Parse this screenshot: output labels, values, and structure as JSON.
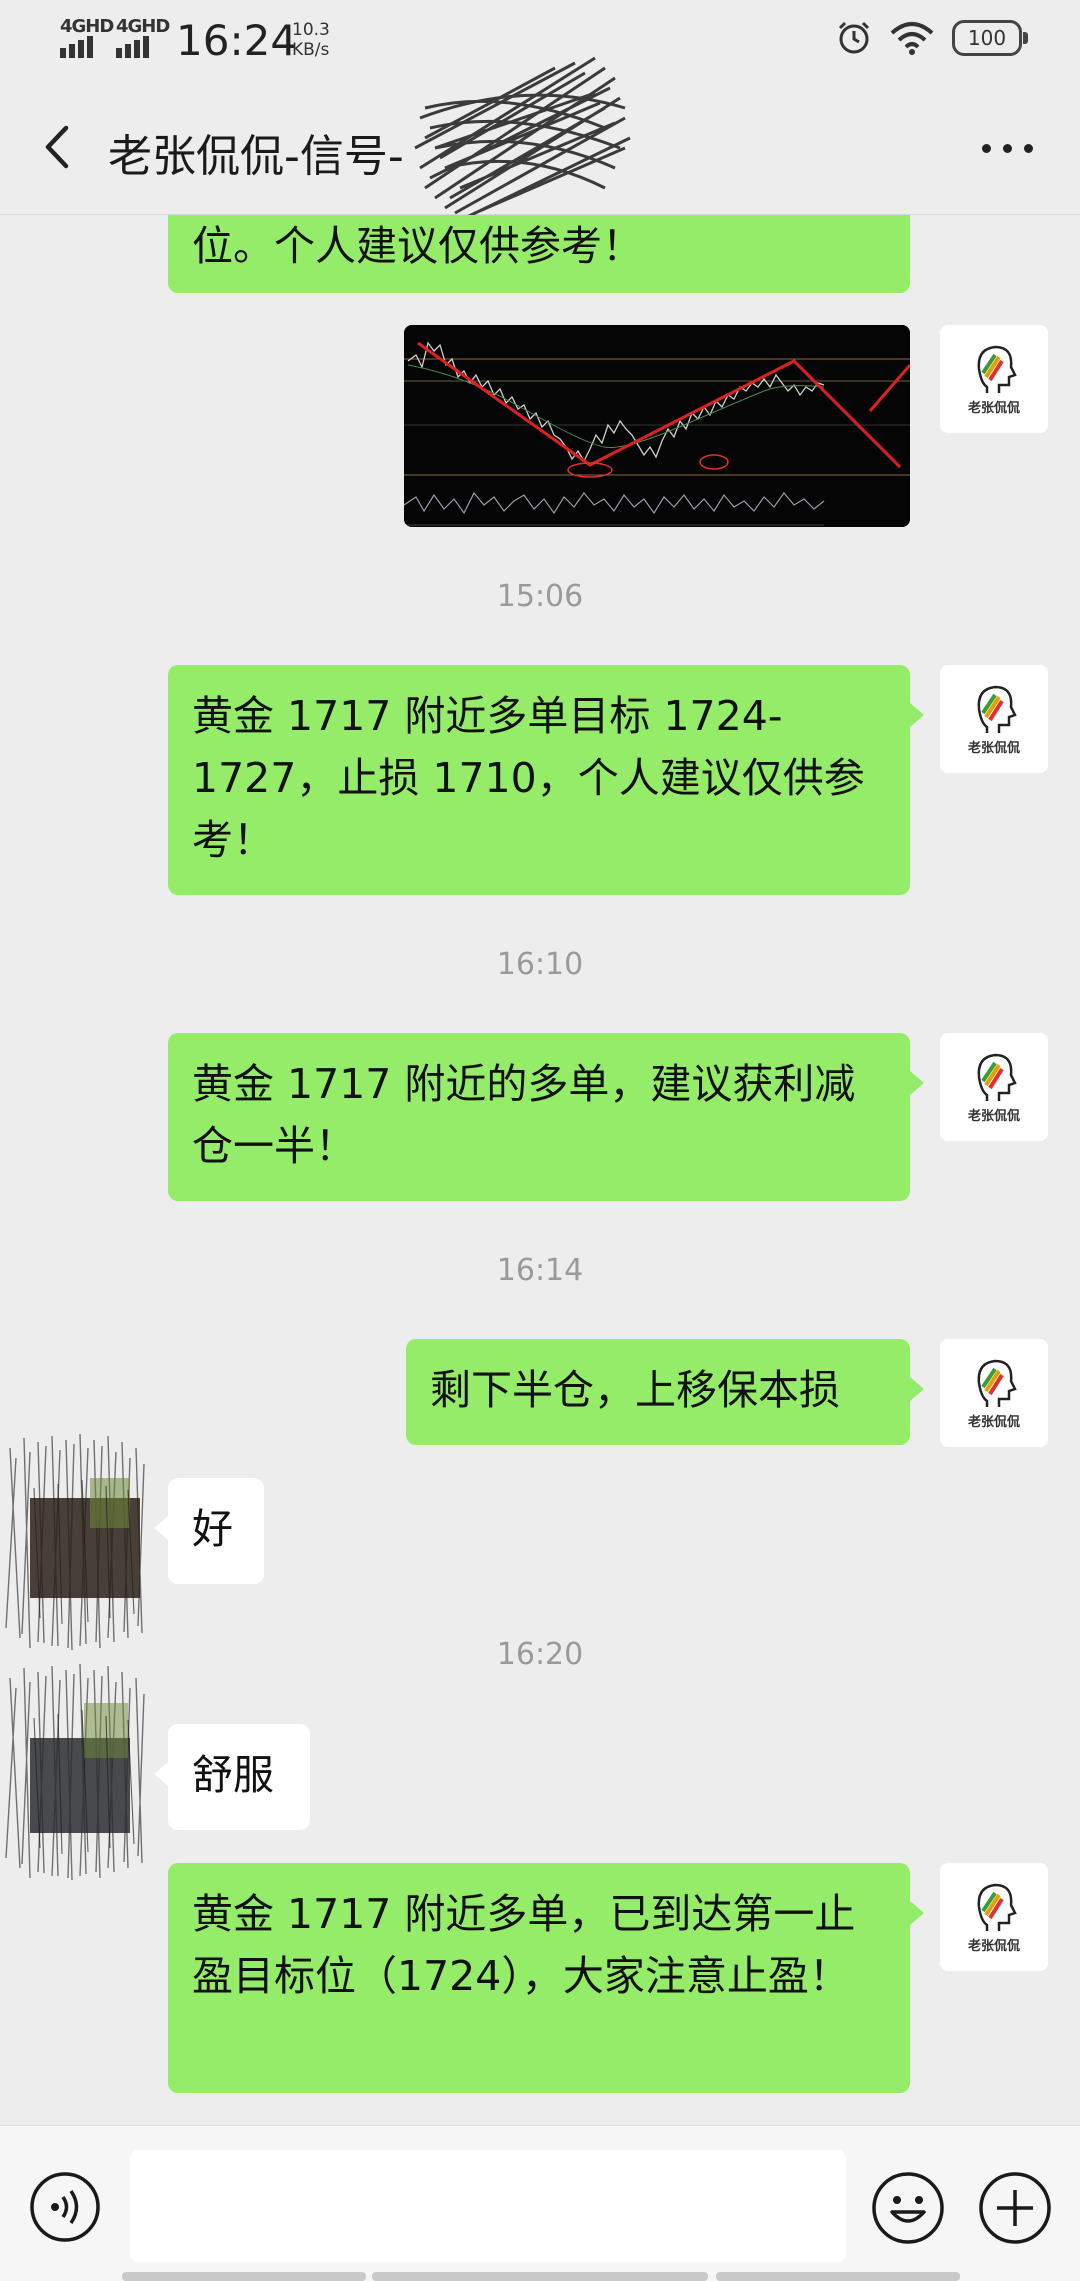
{
  "status_bar": {
    "net1": "4GHD",
    "net2": "4GHD",
    "time": "16:24",
    "speed_value": "10.3",
    "speed_unit": "KB/s",
    "battery": "100"
  },
  "header": {
    "title": "老张侃侃-信号-",
    "icons": [
      "back-arrow-icon",
      "more-icon"
    ]
  },
  "avatar_logo_text": "老张侃侃",
  "messages": [
    {
      "side": "right",
      "type": "text",
      "text": "位。个人建议仅供参考！"
    },
    {
      "side": "right",
      "type": "image",
      "icon": "candlestick-chart-image"
    },
    {
      "type": "time",
      "text": "15:06"
    },
    {
      "side": "right",
      "type": "text",
      "text": "黄金 1717 附近多单目标 1724-1727，止损 1710，个人建议仅供参考！"
    },
    {
      "type": "time",
      "text": "16:10"
    },
    {
      "side": "right",
      "type": "text",
      "text": "黄金 1717 附近的多单，建议获利减仓一半！"
    },
    {
      "type": "time",
      "text": "16:14"
    },
    {
      "side": "right",
      "type": "text",
      "text": "剩下半仓，上移保本损"
    },
    {
      "side": "left",
      "type": "text",
      "text": "好"
    },
    {
      "type": "time",
      "text": "16:20"
    },
    {
      "side": "left",
      "type": "text",
      "text": "舒服"
    },
    {
      "side": "right",
      "type": "text",
      "text": "黄金 1717 附近多单，已到达第一止盈目标位（1724），大家注意止盈！"
    }
  ],
  "input_bar": {
    "placeholder": "",
    "icons": [
      "voice-icon",
      "emoji-icon",
      "plus-icon"
    ]
  },
  "colors": {
    "background": "#ededed",
    "self_bubble": "#95ec69",
    "other_bubble": "#ffffff",
    "timestamp": "#9a9a9a"
  }
}
